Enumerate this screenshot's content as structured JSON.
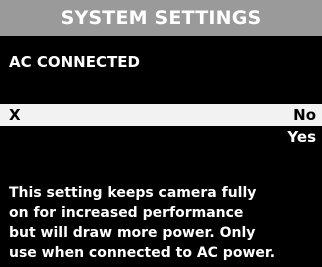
{
  "header": {
    "title": "SYSTEM SETTINGS"
  },
  "setting": {
    "name": "AC CONNECTED"
  },
  "options": [
    {
      "marker": "X",
      "label": "No",
      "selected": true
    },
    {
      "marker": "",
      "label": "Yes",
      "selected": false
    }
  ],
  "description": {
    "lines": [
      "This setting keeps camera fully",
      "on for increased performance",
      "but will draw more power. Only",
      "use when connected to AC power."
    ]
  },
  "colors": {
    "header_bg": "#9a9a9a",
    "background": "#000000",
    "selected_row_bg": "#f2f2f2",
    "text": "#ffffff",
    "selected_text": "#000000"
  }
}
